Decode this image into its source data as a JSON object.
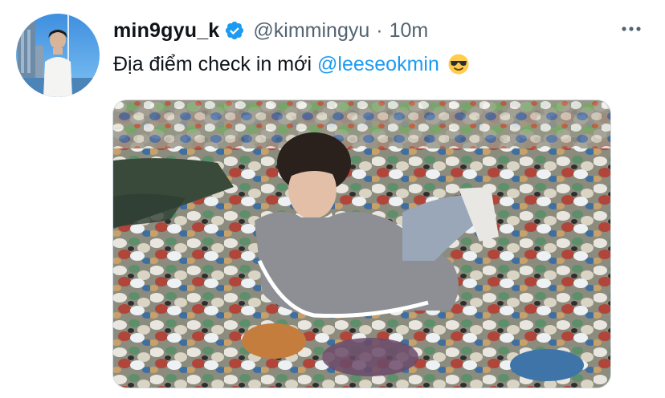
{
  "tweet": {
    "display_name": "min9gyu_k",
    "handle": "@kimmingyu",
    "separator": "·",
    "time": "10m",
    "text": "Địa điểm check in mới",
    "mention": "@leeseokmin",
    "emoji": "sunglasses-face"
  },
  "icons": {
    "verified": "verified-badge-icon",
    "more": "more-horizontal-icon"
  },
  "colors": {
    "accent": "#1d9bf0",
    "text_primary": "#0f1419",
    "text_secondary": "#536471"
  }
}
